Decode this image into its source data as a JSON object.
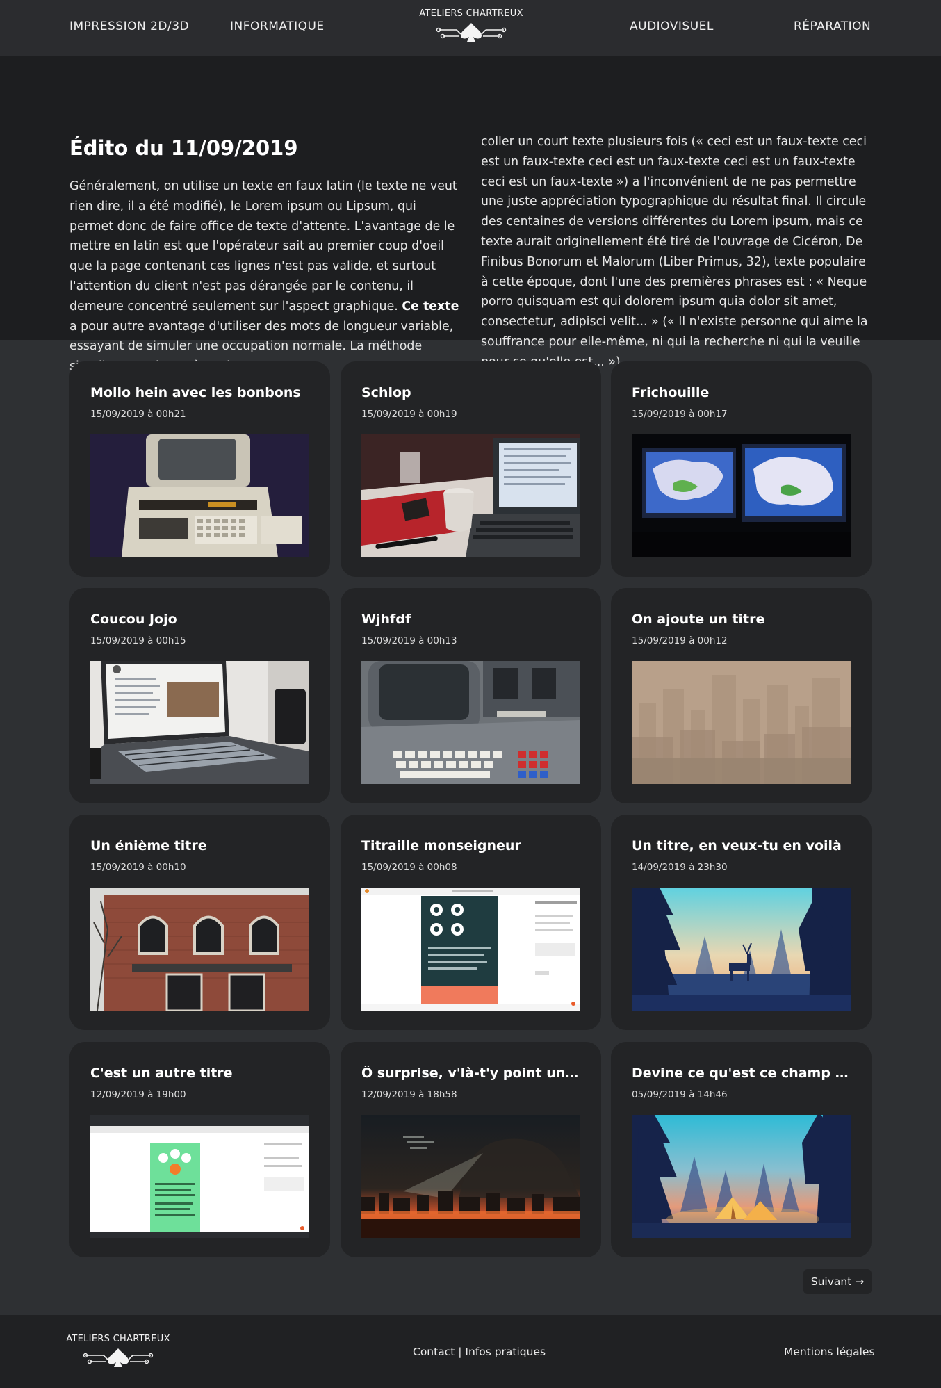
{
  "header": {
    "nav_left": [
      "IMPRESSION 2D/3D",
      "INFORMATIQUE"
    ],
    "logo_text": "ATELIERS CHARTREUX",
    "nav_right": [
      "AUDIOVISUEL",
      "RÉPARATION"
    ]
  },
  "edito": {
    "title": "Édito du 11/09/2019",
    "left_before_bold": "Généralement, on utilise un texte en faux latin (le texte ne veut rien dire, il a été modifié), le Lorem ipsum ou Lipsum, qui permet donc de faire office de texte d'attente. L'avantage de le mettre en latin est que l'opérateur sait au premier coup d'oeil que la page contenant ces lignes n'est pas valide, et surtout l'attention du client n'est pas dérangée par le contenu, il demeure concentré seulement sur l'aspect graphique. ",
    "bold": "Ce texte",
    "left_after_bold": " a pour autre avantage d'utiliser des mots de longueur variable, essayant de simuler une occupation normale. La méthode simpliste consistant à copier-",
    "right": "coller un court texte plusieurs fois (« ceci est un faux-texte ceci est un faux-texte ceci est un faux-texte ceci est un faux-texte ceci est un faux-texte ») a l'inconvénient de ne pas permettre une juste appréciation typographique du résultat final. Il circule des centaines de versions différentes du Lorem ipsum, mais ce texte aurait originellement été tiré de l'ouvrage de Cicéron, De Finibus Bonorum et Malorum (Liber Primus, 32), texte populaire à cette époque, dont l'une des premières phrases est : « Neque porro quisquam est qui dolorem ipsum quia dolor sit amet, consectetur, adipisci velit... » (« Il n'existe personne qui aime la souffrance pour elle-même, ni qui la recherche ni qui la veuille pour ce qu'elle est... »)."
  },
  "posts": [
    {
      "title": "Mollo hein avec les bonbons",
      "date": "15/09/2019 à 00h21",
      "image": "retro-pet-computer-photo"
    },
    {
      "title": "Schlop",
      "date": "15/09/2019 à 00h19",
      "image": "laptop-coffee-desk-photo"
    },
    {
      "title": "Frichouille",
      "date": "15/09/2019 à 00h17",
      "image": "two-monitors-maps-photo"
    },
    {
      "title": "Coucou Jojo",
      "date": "15/09/2019 à 00h15",
      "image": "laptop-wikipedia-photo"
    },
    {
      "title": "Wjhfdf",
      "date": "15/09/2019 à 00h13",
      "image": "vintage-terminal-keyboard-photo"
    },
    {
      "title": "On ajoute un titre",
      "date": "15/09/2019 à 00h12",
      "image": "smoggy-city-skyline-photo"
    },
    {
      "title": "Un énième titre",
      "date": "15/09/2019 à 00h10",
      "image": "brick-house-windows-photo"
    },
    {
      "title": "Titraille monseigneur",
      "date": "15/09/2019 à 00h08",
      "image": "mobile-page-editor-screenshot"
    },
    {
      "title": "Un titre, en veux-tu en voilà",
      "date": "14/09/2019 à 23h30",
      "image": "deer-forest-sunrise-illustration"
    },
    {
      "title": "C'est un autre titre",
      "date": "12/09/2019 à 19h00",
      "image": "page-editor-green-screenshot"
    },
    {
      "title": "Ô surprise, v'là-t'y point un joli titre",
      "date": "12/09/2019 à 18h58",
      "image": "burning-city-monster-illustration"
    },
    {
      "title": "Devine ce qu'est ce champ (spoiler)",
      "date": "05/09/2019 à 14h46",
      "image": "tents-forest-dusk-illustration"
    }
  ],
  "pagination": {
    "next_label": "Suivant →"
  },
  "footer": {
    "logo_text": "ATELIERS CHARTREUX",
    "center_link": "Contact | Infos pratiques",
    "right_link": "Mentions légales"
  }
}
